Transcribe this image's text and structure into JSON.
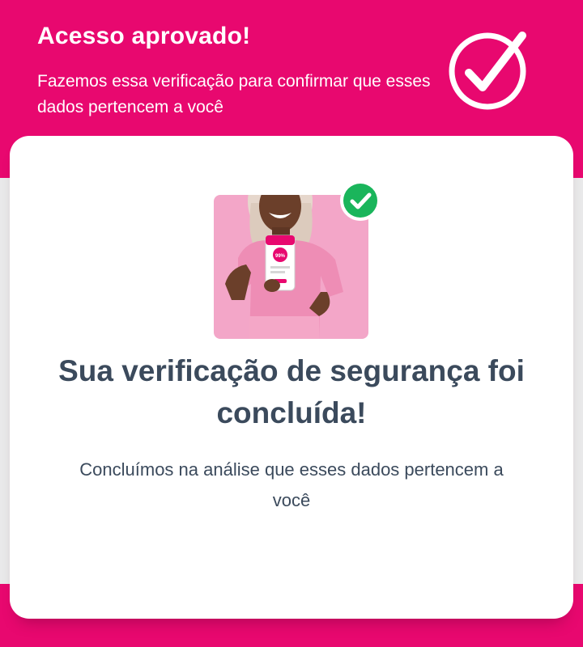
{
  "header": {
    "title": "Acesso aprovado!",
    "subtitle": "Fazemos essa verificação para confirmar que esses dados pertencem a você",
    "icon": "check-circle-icon"
  },
  "card": {
    "photo_icon": "woman-holding-phone-photo",
    "badge_icon": "check-badge-icon",
    "phone_badge_text": "99%",
    "title": "Sua verificação de segurança foi concluída!",
    "description": "Concluímos na análise que esses dados pertencem a você"
  },
  "colors": {
    "brand_pink": "#e8086f",
    "text_dark": "#3b4a5c",
    "check_green": "#1ab55b",
    "photo_bg": "#f3a6c8"
  }
}
